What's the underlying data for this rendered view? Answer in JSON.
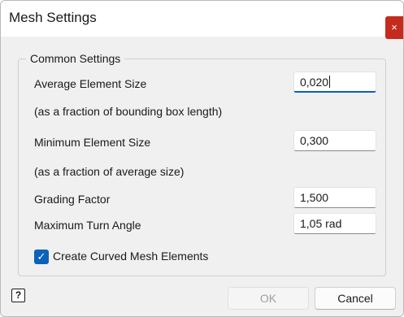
{
  "dialog": {
    "title": "Mesh Settings",
    "close_label": "×"
  },
  "common_settings": {
    "legend": "Common Settings",
    "average_element_size": {
      "label": "Average Element Size",
      "value": "0,020"
    },
    "average_hint": "(as a fraction of bounding box length)",
    "minimum_element_size": {
      "label": "Minimum Element Size",
      "value": "0,300"
    },
    "minimum_hint": "(as a fraction of average size)",
    "grading_factor": {
      "label": "Grading Factor",
      "value": "1,500"
    },
    "max_turn_angle": {
      "label": "Maximum Turn Angle",
      "value": "1,05 rad"
    },
    "curved_elements": {
      "label": "Create Curved Mesh Elements",
      "checked": true,
      "check_glyph": "✓"
    }
  },
  "footer": {
    "help_glyph": "?",
    "ok_label": "OK",
    "cancel_label": "Cancel"
  },
  "colors": {
    "accent": "#0a62b9",
    "close": "#c42b1c"
  }
}
